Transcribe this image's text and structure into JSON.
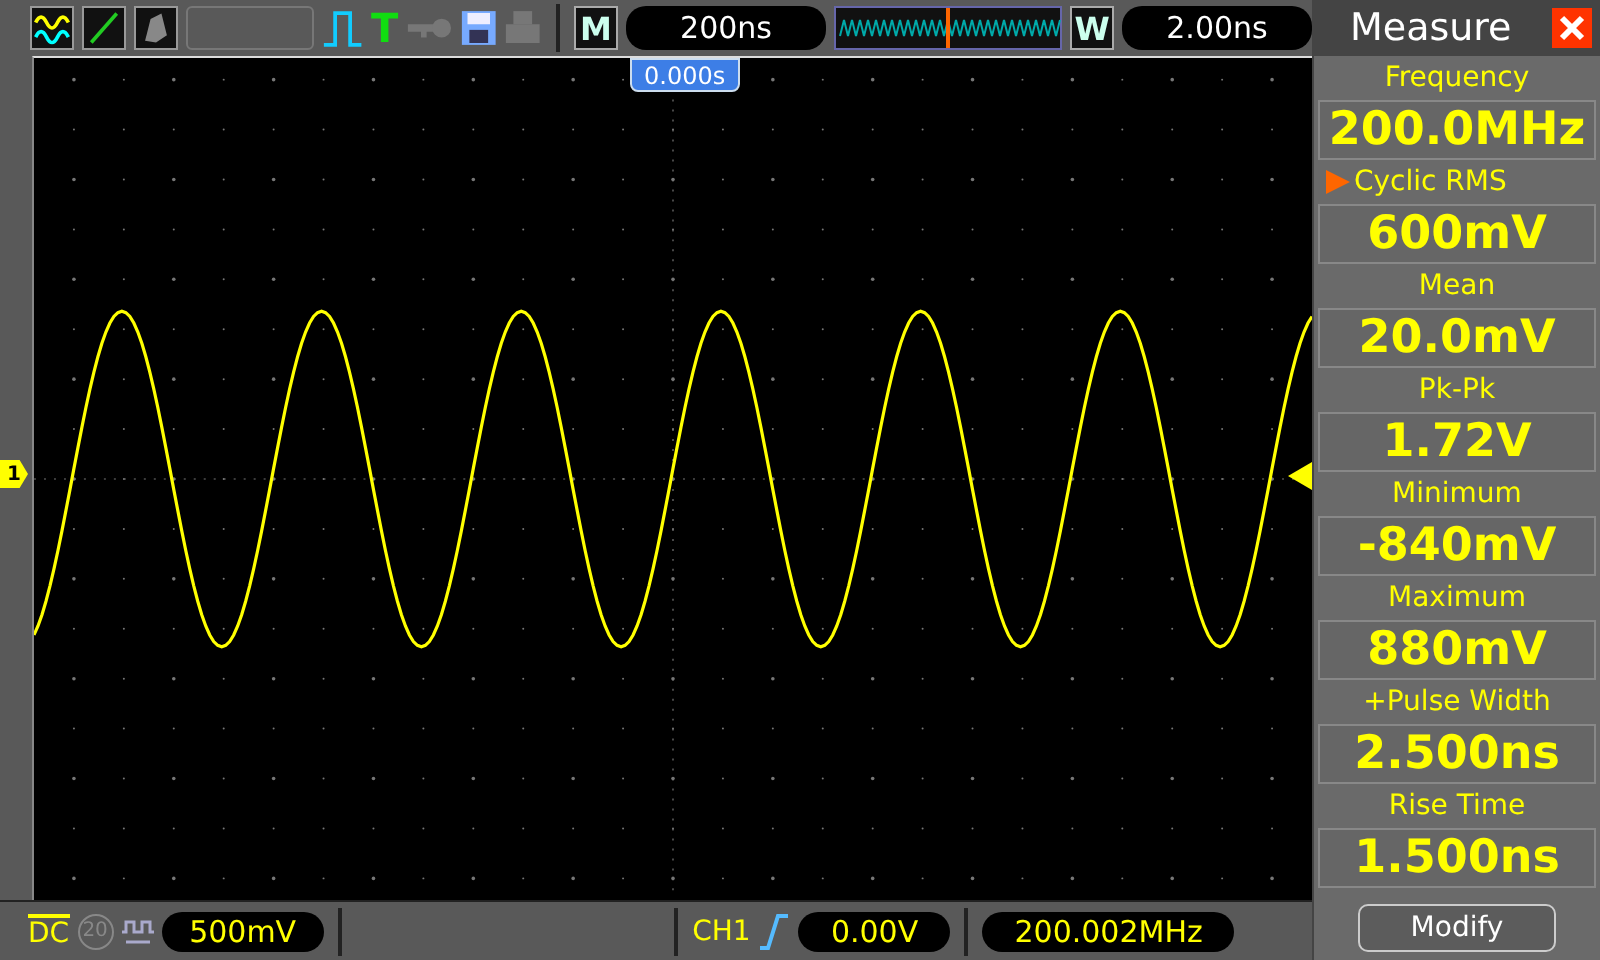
{
  "toolbar": {
    "trigger_letter": "T",
    "mode_letter": "M",
    "timebase": "200ns",
    "window_letter": "W",
    "window_timebase": "2.00ns"
  },
  "screen": {
    "trigger_position": "0.000s",
    "channel_marker": "1"
  },
  "status_bar": {
    "coupling": "DC",
    "bandwidth_limit": {
      "label": "20",
      "on": false
    },
    "volts_per_div": "500mV",
    "trigger_source": "CH1",
    "trigger_level": "0.00V",
    "frequency": "200.002MHz"
  },
  "measure_panel": {
    "title": "Measure",
    "items": [
      {
        "label": "Frequency",
        "value": "200.0MHz",
        "selected": false
      },
      {
        "label": "Cyclic RMS",
        "value": "600mV",
        "selected": true
      },
      {
        "label": "Mean",
        "value": "20.0mV",
        "selected": false
      },
      {
        "label": "Pk-Pk",
        "value": "1.72V",
        "selected": false
      },
      {
        "label": "Minimum",
        "value": "-840mV",
        "selected": false
      },
      {
        "label": "Maximum",
        "value": "880mV",
        "selected": false
      },
      {
        "label": "+Pulse Width",
        "value": "2.500ns",
        "selected": false
      },
      {
        "label": "Rise Time",
        "value": "1.500ns",
        "selected": false
      }
    ],
    "button": "Modify"
  }
}
